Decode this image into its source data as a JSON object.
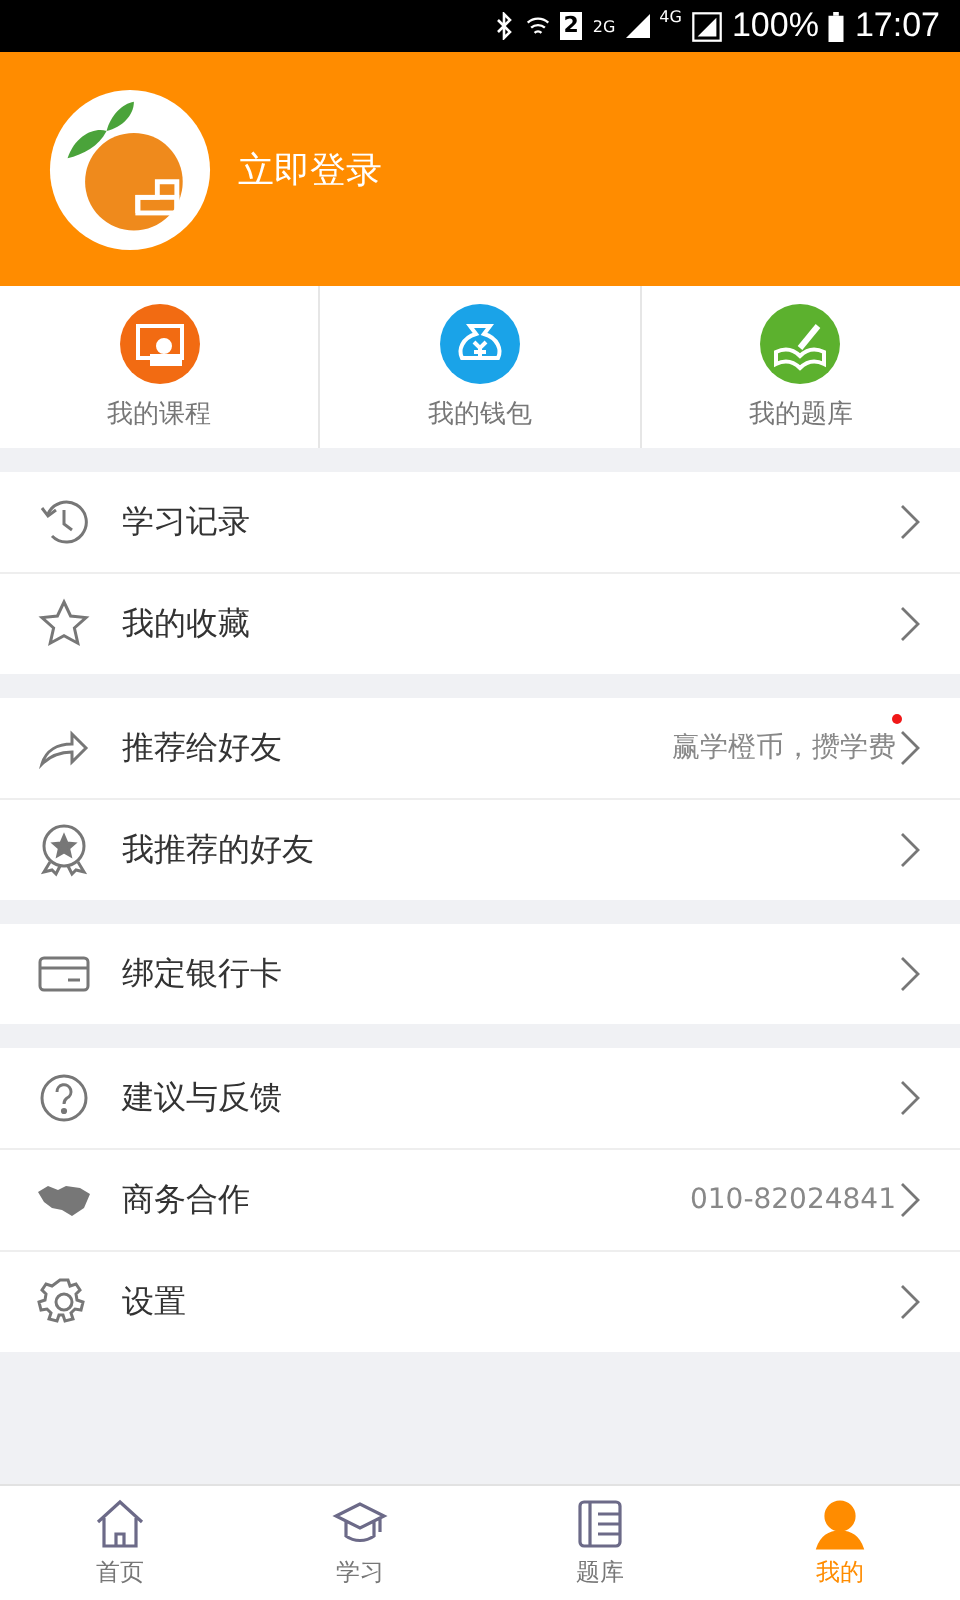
{
  "status_bar": {
    "sim": "2",
    "net_2g": "2G",
    "net_4g": "4G",
    "battery": "100%",
    "time": "17:07"
  },
  "header": {
    "login": "立即登录"
  },
  "shortcuts": [
    {
      "label": "我的课程"
    },
    {
      "label": "我的钱包"
    },
    {
      "label": "我的题库"
    }
  ],
  "menu_groups": [
    {
      "items": [
        {
          "label": "学习记录"
        },
        {
          "label": "我的收藏"
        }
      ]
    },
    {
      "items": [
        {
          "label": "推荐给好友",
          "detail": "赢学橙币，攒学费",
          "new_dot": true
        },
        {
          "label": "我推荐的好友",
          "new_dot": false
        }
      ]
    },
    {
      "items": [
        {
          "label": "绑定银行卡"
        }
      ]
    },
    {
      "items": [
        {
          "label": "建议与反馈"
        },
        {
          "label": "商务合作",
          "detail": "010-82024841"
        },
        {
          "label": "设置"
        }
      ]
    }
  ],
  "bottom_nav": [
    {
      "label": "首页",
      "selected": false
    },
    {
      "label": "学习",
      "selected": false
    },
    {
      "label": "题库",
      "selected": false
    },
    {
      "label": "我的",
      "selected": true
    }
  ]
}
